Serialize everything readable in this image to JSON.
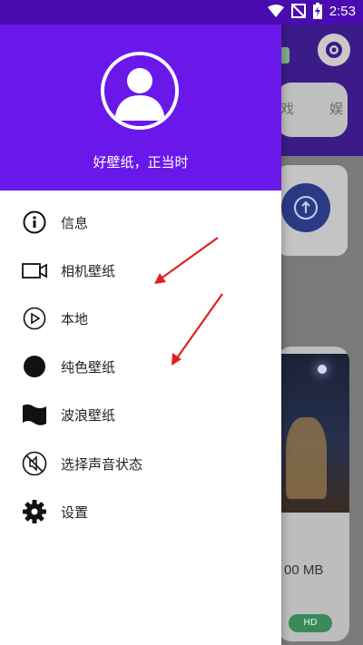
{
  "status_bar": {
    "time": "2:53",
    "icons": [
      "wifi-icon",
      "no-sim-icon",
      "battery-charging-icon"
    ],
    "bg_color": "#4a0cb0"
  },
  "background_app": {
    "search_text_left": "戏",
    "search_text_right": "娱",
    "card_size_text": "00 MB",
    "card_badge": "HD"
  },
  "drawer": {
    "header_color": "#6a18ea",
    "tagline": "好壁纸，正当时",
    "items": [
      {
        "label": "信息",
        "icon": "info-icon"
      },
      {
        "label": "相机壁纸",
        "icon": "camera-icon"
      },
      {
        "label": "本地",
        "icon": "play-circle-icon"
      },
      {
        "label": "纯色壁纸",
        "icon": "filled-circle-icon"
      },
      {
        "label": "波浪壁纸",
        "icon": "wave-flag-icon"
      },
      {
        "label": "选择声音状态",
        "icon": "mute-icon"
      },
      {
        "label": "设置",
        "icon": "gear-icon"
      }
    ]
  },
  "annotation": {
    "arrow_color": "#e02020"
  }
}
